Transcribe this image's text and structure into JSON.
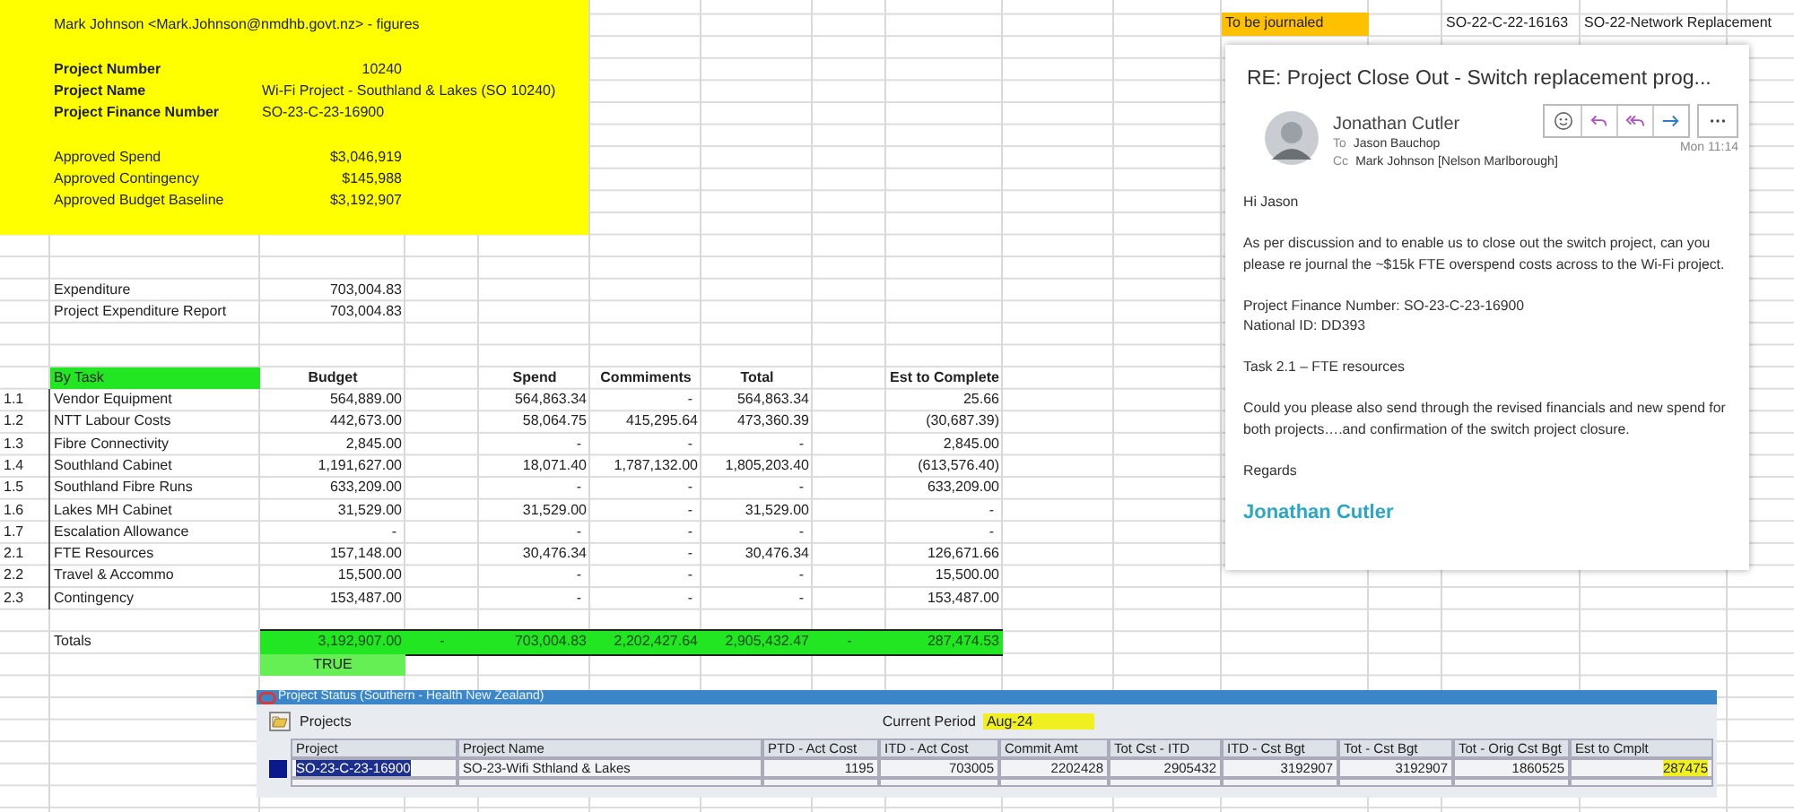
{
  "sheet": {
    "header_block": {
      "title": "Mark Johnson <Mark.Johnson@nmdhb.govt.nz> - figures",
      "fields": [
        {
          "label": "Project Number",
          "value": "10240",
          "kind": "number"
        },
        {
          "label": "Project Name",
          "value": "Wi-Fi Project - Southland & Lakes (SO 10240)",
          "kind": "text"
        },
        {
          "label": "Project Finance Number",
          "value": "SO-23-C-23-16900",
          "kind": "text"
        }
      ],
      "amounts": [
        {
          "label": "Approved Spend",
          "value": "$3,046,919"
        },
        {
          "label": "Approved Contingency",
          "value": "$145,988"
        },
        {
          "label": "Approved Budget Baseline",
          "value": "$3,192,907"
        }
      ]
    },
    "expenditure": [
      {
        "label": "Expenditure",
        "value": "703,004.83"
      },
      {
        "label": "Project Expenditure Report",
        "value": "703,004.83"
      }
    ],
    "tasks": {
      "headers": {
        "name": "By Task",
        "budget": "Budget",
        "spend": "Spend",
        "commitments": "Commiments",
        "total": "Total",
        "est_to_complete": "Est to Complete"
      },
      "rows": [
        {
          "number": "1.1",
          "name": "Vendor Equipment",
          "budget": "564,889.00",
          "spend": "564,863.34",
          "commitments": "-",
          "total": "564,863.34",
          "est_to_complete": "25.66"
        },
        {
          "number": "1.2",
          "name": "NTT Labour Costs",
          "budget": "442,673.00",
          "spend": "58,064.75",
          "commitments": "415,295.64",
          "total": "473,360.39",
          "est_to_complete": "(30,687.39)"
        },
        {
          "number": "1.3",
          "name": "Fibre Connectivity",
          "budget": "2,845.00",
          "spend": "-",
          "commitments": "-",
          "total": "-",
          "est_to_complete": "2,845.00"
        },
        {
          "number": "1.4",
          "name": "Southland Cabinet",
          "budget": "1,191,627.00",
          "spend": "18,071.40",
          "commitments": "1,787,132.00",
          "total": "1,805,203.40",
          "est_to_complete": "(613,576.40)"
        },
        {
          "number": "1.5",
          "name": "Southland Fibre Runs",
          "budget": "633,209.00",
          "spend": "-",
          "commitments": "-",
          "total": "-",
          "est_to_complete": "633,209.00"
        },
        {
          "number": "1.6",
          "name": "Lakes MH Cabinet",
          "budget": "31,529.00",
          "spend": "31,529.00",
          "commitments": "-",
          "total": "31,529.00",
          "est_to_complete": "-"
        },
        {
          "number": "1.7",
          "name": "Escalation Allowance",
          "budget": "-",
          "spend": "-",
          "commitments": "-",
          "total": "-",
          "est_to_complete": "-"
        },
        {
          "number": "2.1",
          "name": "FTE Resources",
          "budget": "157,148.00",
          "spend": "30,476.34",
          "commitments": "-",
          "total": "30,476.34",
          "est_to_complete": "126,671.66"
        },
        {
          "number": "2.2",
          "name": "Travel & Accommo",
          "budget": "15,500.00",
          "spend": "-",
          "commitments": "-",
          "total": "-",
          "est_to_complete": "15,500.00"
        },
        {
          "number": "2.3",
          "name": "Contingency",
          "budget": "153,487.00",
          "spend": "-",
          "commitments": "-",
          "total": "-",
          "est_to_complete": "153,487.00"
        }
      ]
    },
    "totals": {
      "label": "Totals",
      "budget": "3,192,907.00",
      "column_4": "-",
      "spend": "703,004.83",
      "commitments": "2,202,427.64",
      "total": "2,905,432.47",
      "column_8": "-",
      "est_to_complete": "287,474.53"
    },
    "check": "TRUE",
    "journal": {
      "status": "To be journaled",
      "code": "SO-22-C-22-16163",
      "name": "SO-22-Network Replacement"
    }
  },
  "email": {
    "subject": "RE: Project Close Out - Switch replacement prog...",
    "sender": "Jonathan Cutler",
    "to_label": "To",
    "to": "Jason Bauchop",
    "cc_label": "Cc",
    "cc": "Mark Johnson [Nelson Marlborough]",
    "time": "Mon 11:14",
    "body": [
      [
        "Hi Jason"
      ],
      [
        "As per discussion and to enable us to close out the switch project, can you please re journal the ~$15k FTE overspend costs across to the Wi-Fi project."
      ],
      [
        "Project Finance Number: SO-23-C-23-16900",
        "National ID: DD393"
      ],
      [
        "Task 2.1 – FTE resources"
      ],
      [
        "Could you please also send through the revised financials and new spend for both projects….and confirmation of the switch project closure."
      ],
      [
        "Regards"
      ]
    ],
    "signature": "Jonathan Cutler"
  },
  "project_status": {
    "title": "Project Status (Southern - Health New Zealand)",
    "section": "Projects",
    "period": {
      "label": "Current Period",
      "value": "Aug-24",
      "highlighted": true
    },
    "columns": [
      {
        "label": "Project",
        "kind": "text"
      },
      {
        "label": "Project Name",
        "kind": "text"
      },
      {
        "label": "PTD - Act Cost",
        "kind": "number"
      },
      {
        "label": "ITD - Act Cost",
        "kind": "number"
      },
      {
        "label": "Commit Amt",
        "kind": "number"
      },
      {
        "label": "Tot Cst - ITD",
        "kind": "number"
      },
      {
        "label": "ITD - Cst Bgt",
        "kind": "number"
      },
      {
        "label": "Tot - Cst Bgt",
        "kind": "number"
      },
      {
        "label": "Tot - Orig Cst Bgt",
        "kind": "number"
      },
      {
        "label": "Est to Cmplt",
        "kind": "number"
      }
    ],
    "rows": [
      {
        "selected": true,
        "cells": [
          {
            "text": "SO-23-C-23-16900",
            "selected": true,
            "highlighted": false
          },
          {
            "text": "SO-23-Wifi Sthland & Lakes",
            "selected": false,
            "highlighted": false
          },
          {
            "text": "1195",
            "selected": false,
            "highlighted": false
          },
          {
            "text": "703005",
            "selected": false,
            "highlighted": false
          },
          {
            "text": "2202428",
            "selected": false,
            "highlighted": false
          },
          {
            "text": "2905432",
            "selected": false,
            "highlighted": false
          },
          {
            "text": "3192907",
            "selected": false,
            "highlighted": false
          },
          {
            "text": "3192907",
            "selected": false,
            "highlighted": false
          },
          {
            "text": "1860525",
            "selected": false,
            "highlighted": false
          },
          {
            "text": "287475",
            "selected": false,
            "highlighted": true
          }
        ]
      }
    ]
  }
}
